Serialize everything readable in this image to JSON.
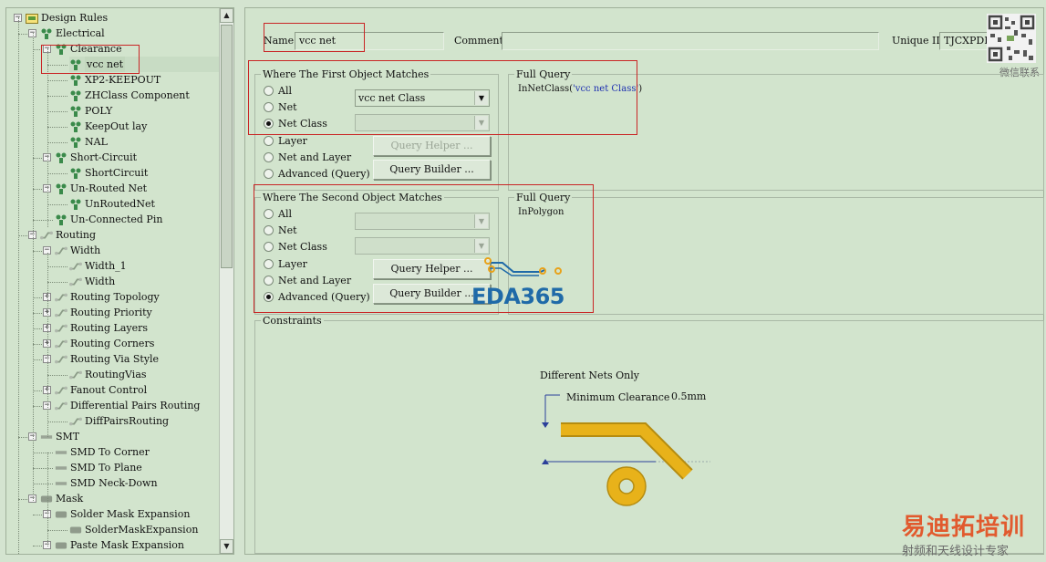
{
  "tree": {
    "items": [
      {
        "label": "Design Rules",
        "level": 0,
        "icon": "rules-root-icon",
        "expander": "−"
      },
      {
        "label": "Electrical",
        "level": 1,
        "icon": "electrical-icon",
        "expander": "−"
      },
      {
        "label": "Clearance",
        "level": 2,
        "icon": "clearance-icon",
        "expander": "−"
      },
      {
        "label": "vcc net",
        "level": 3,
        "icon": "rule-icon",
        "expander": ""
      },
      {
        "label": "XP2-KEEPOUT",
        "level": 3,
        "icon": "rule-icon",
        "expander": ""
      },
      {
        "label": "ZHClass Component",
        "level": 3,
        "icon": "rule-icon",
        "expander": ""
      },
      {
        "label": "POLY",
        "level": 3,
        "icon": "rule-icon",
        "expander": ""
      },
      {
        "label": "KeepOut lay",
        "level": 3,
        "icon": "rule-icon",
        "expander": ""
      },
      {
        "label": "NAL",
        "level": 3,
        "icon": "rule-icon",
        "expander": ""
      },
      {
        "label": "Short-Circuit",
        "level": 2,
        "icon": "short-circuit-icon",
        "expander": "−"
      },
      {
        "label": "ShortCircuit",
        "level": 3,
        "icon": "rule-icon",
        "expander": ""
      },
      {
        "label": "Un-Routed Net",
        "level": 2,
        "icon": "unrouted-icon",
        "expander": "−"
      },
      {
        "label": "UnRoutedNet",
        "level": 3,
        "icon": "rule-icon",
        "expander": ""
      },
      {
        "label": "Un-Connected Pin",
        "level": 2,
        "icon": "unconnected-icon",
        "expander": ""
      },
      {
        "label": "Routing",
        "level": 1,
        "icon": "routing-icon",
        "expander": "−"
      },
      {
        "label": "Width",
        "level": 2,
        "icon": "width-icon",
        "expander": "−"
      },
      {
        "label": "Width_1",
        "level": 3,
        "icon": "route-rule-icon",
        "expander": ""
      },
      {
        "label": "Width",
        "level": 3,
        "icon": "route-rule-icon",
        "expander": ""
      },
      {
        "label": "Routing Topology",
        "level": 2,
        "icon": "topology-icon",
        "expander": "+"
      },
      {
        "label": "Routing Priority",
        "level": 2,
        "icon": "priority-icon",
        "expander": "+"
      },
      {
        "label": "Routing Layers",
        "level": 2,
        "icon": "layers-icon",
        "expander": "+"
      },
      {
        "label": "Routing Corners",
        "level": 2,
        "icon": "corners-icon",
        "expander": "+"
      },
      {
        "label": "Routing Via Style",
        "level": 2,
        "icon": "via-style-icon",
        "expander": "−"
      },
      {
        "label": "RoutingVias",
        "level": 3,
        "icon": "route-rule-icon",
        "expander": ""
      },
      {
        "label": "Fanout Control",
        "level": 2,
        "icon": "fanout-icon",
        "expander": "+"
      },
      {
        "label": "Differential Pairs Routing",
        "level": 2,
        "icon": "diff-pairs-icon",
        "expander": "−"
      },
      {
        "label": "DiffPairsRouting",
        "level": 3,
        "icon": "route-rule-icon",
        "expander": ""
      },
      {
        "label": "SMT",
        "level": 1,
        "icon": "smt-icon",
        "expander": "−"
      },
      {
        "label": "SMD To Corner",
        "level": 2,
        "icon": "smd-icon",
        "expander": ""
      },
      {
        "label": "SMD To Plane",
        "level": 2,
        "icon": "smd-icon",
        "expander": ""
      },
      {
        "label": "SMD Neck-Down",
        "level": 2,
        "icon": "smd-icon",
        "expander": ""
      },
      {
        "label": "Mask",
        "level": 1,
        "icon": "mask-icon",
        "expander": "−"
      },
      {
        "label": "Solder Mask Expansion",
        "level": 2,
        "icon": "solder-mask-icon",
        "expander": "−"
      },
      {
        "label": "SolderMaskExpansion",
        "level": 3,
        "icon": "mask-rule-icon",
        "expander": ""
      },
      {
        "label": "Paste Mask Expansion",
        "level": 2,
        "icon": "paste-mask-icon",
        "expander": "−"
      }
    ],
    "selected_index": 3,
    "scroll_up": "▲",
    "scroll_down": "▼"
  },
  "rule": {
    "name_label": "Name",
    "name_value": "vcc net",
    "comment_label": "Comment",
    "comment_value": "",
    "uid_label": "Unique ID",
    "uid_value": "TJCXPDBF"
  },
  "first": {
    "title": "Where The First Object Matches",
    "options": [
      "All",
      "Net",
      "Net Class",
      "Layer",
      "Net and Layer",
      "Advanced (Query)"
    ],
    "checked": 2,
    "combo1": "vcc net Class",
    "combo2": "",
    "query_helper": "Query Helper ...",
    "query_builder": "Query Builder ...",
    "full_query_title": "Full Query",
    "full_query_prefix": "InNetClass(",
    "full_query_arg": "'vcc net Class'",
    "full_query_suffix": ")"
  },
  "second": {
    "title": "Where The Second Object Matches",
    "options": [
      "All",
      "Net",
      "Net Class",
      "Layer",
      "Net and Layer",
      "Advanced (Query)"
    ],
    "checked": 5,
    "query_helper": "Query Helper ...",
    "query_builder": "Query Builder ...",
    "full_query_title": "Full Query",
    "full_query": "InPolygon"
  },
  "constraints": {
    "title": "Constraints",
    "heading": "Different Nets Only",
    "min_label": "Minimum Clearance",
    "min_value": "0.5mm"
  },
  "watermarks": {
    "eda": "EDA365",
    "cn_main": "易迪拓培训",
    "cn_sub": "射频和天线设计专家",
    "wechat": "微信联系"
  },
  "colors": {
    "panel_bg": "#d2e4cd",
    "highlight_box": "#c92525",
    "trace_gold": "#e8b21a",
    "watermark_blue": "#1f6aa8",
    "watermark_orange": "#e15a2e"
  }
}
